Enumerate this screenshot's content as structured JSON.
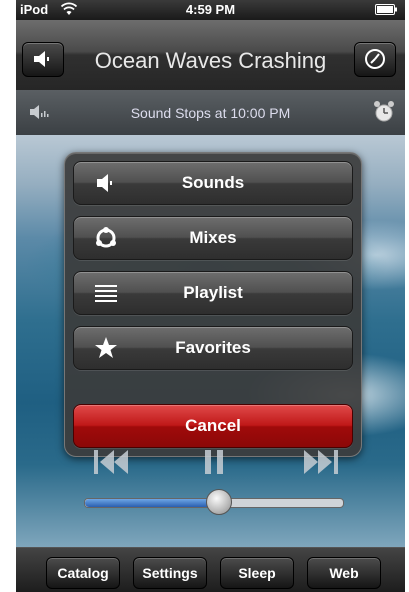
{
  "status": {
    "carrier": "iPod",
    "time": "4:59 PM"
  },
  "title": "Ocean Waves Crashing",
  "info": {
    "stop_text": "Sound Stops at 10:00 PM"
  },
  "menu": {
    "items": [
      {
        "label": "Sounds",
        "icon": "speaker-icon"
      },
      {
        "label": "Mixes",
        "icon": "mix-icon"
      },
      {
        "label": "Playlist",
        "icon": "list-icon"
      },
      {
        "label": "Favorites",
        "icon": "star-icon"
      }
    ],
    "cancel_label": "Cancel"
  },
  "player": {
    "volume": 0.52
  },
  "toolbar": {
    "items": [
      {
        "label": "Catalog"
      },
      {
        "label": "Settings"
      },
      {
        "label": "Sleep"
      },
      {
        "label": "Web"
      }
    ]
  },
  "colors": {
    "cancel": "#c01818",
    "slider_fill": "#2a5fb0"
  }
}
